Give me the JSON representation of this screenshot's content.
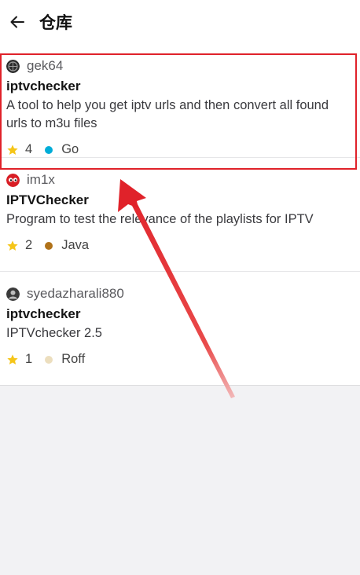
{
  "header": {
    "title": "仓库"
  },
  "repos": [
    {
      "owner": "gek64",
      "name": "iptvchecker",
      "description": "A tool to help you get iptv urls and then convert all found urls to m3u files",
      "stars": "4",
      "language": "Go",
      "language_color": "#00add8"
    },
    {
      "owner": "im1x",
      "name": "IPTVChecker",
      "description": "Program to test the relevance of the playlists for IPTV",
      "stars": "2",
      "language": "Java",
      "language_color": "#b07219"
    },
    {
      "owner": "syedazharali880",
      "name": "iptvchecker",
      "description": "IPTVchecker 2.5",
      "stars": "1",
      "language": "Roff",
      "language_color": "#ecdebe"
    }
  ],
  "annotation": {
    "highlight_color": "#e0222a"
  }
}
